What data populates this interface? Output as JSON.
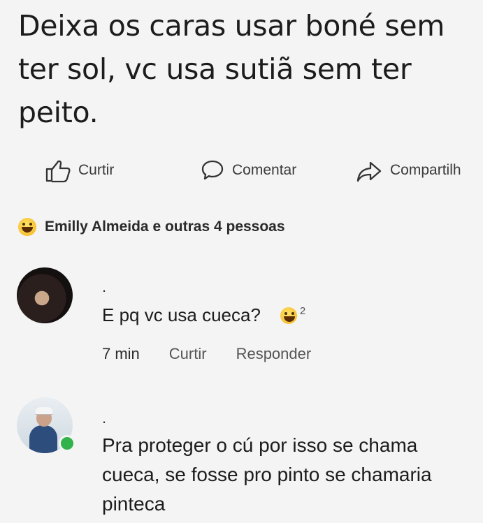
{
  "post": {
    "text": "Deixa os caras usar boné sem ter sol, vc usa sutiã sem ter peito."
  },
  "actions": {
    "like_label": "Curtir",
    "comment_label": "Comentar",
    "share_label": "Compartilh"
  },
  "reactions": {
    "summary": "Emilly Almeida e outras 4 pessoas"
  },
  "comments": [
    {
      "author": ".",
      "text": "E pq vc usa cueca?",
      "reaction_count": "2",
      "time": "7 min",
      "like_label": "Curtir",
      "reply_label": "Responder"
    },
    {
      "author": ".",
      "text": "Pra proteger o cú por isso se chama cueca, se fosse pro pinto se chamaria pinteca"
    }
  ],
  "colors": {
    "background": "#f4f4f4",
    "text": "#1c1c1c",
    "online": "#31b24a"
  }
}
